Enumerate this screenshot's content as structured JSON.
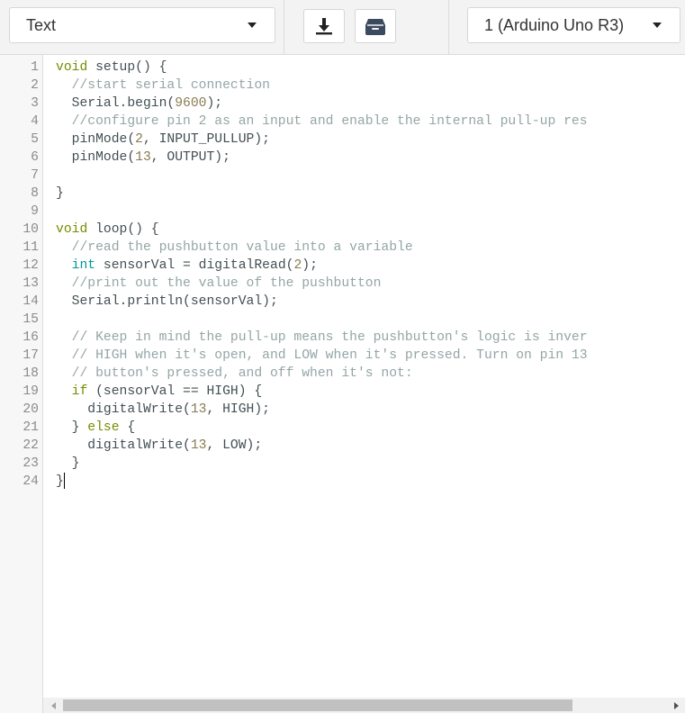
{
  "toolbar": {
    "mode_select": "Text",
    "board_select": "1 (Arduino Uno R3)",
    "download_icon": "download-icon",
    "library_icon": "archive-box-icon"
  },
  "editor": {
    "lines": [
      "void setup() {",
      "  //start serial connection",
      "  Serial.begin(9600);",
      "  //configure pin 2 as an input and enable the internal pull-up res",
      "  pinMode(2, INPUT_PULLUP);",
      "  pinMode(13, OUTPUT);",
      "",
      "}",
      "",
      "void loop() {",
      "  //read the pushbutton value into a variable",
      "  int sensorVal = digitalRead(2);",
      "  //print out the value of the pushbutton",
      "  Serial.println(sensorVal);",
      "",
      "  // Keep in mind the pull-up means the pushbutton's logic is inver",
      "  // HIGH when it's open, and LOW when it's pressed. Turn on pin 13",
      "  // button's pressed, and off when it's not:",
      "  if (sensorVal == HIGH) {",
      "    digitalWrite(13, HIGH);",
      "  } else {",
      "    digitalWrite(13, LOW);",
      "  }",
      "}"
    ]
  }
}
